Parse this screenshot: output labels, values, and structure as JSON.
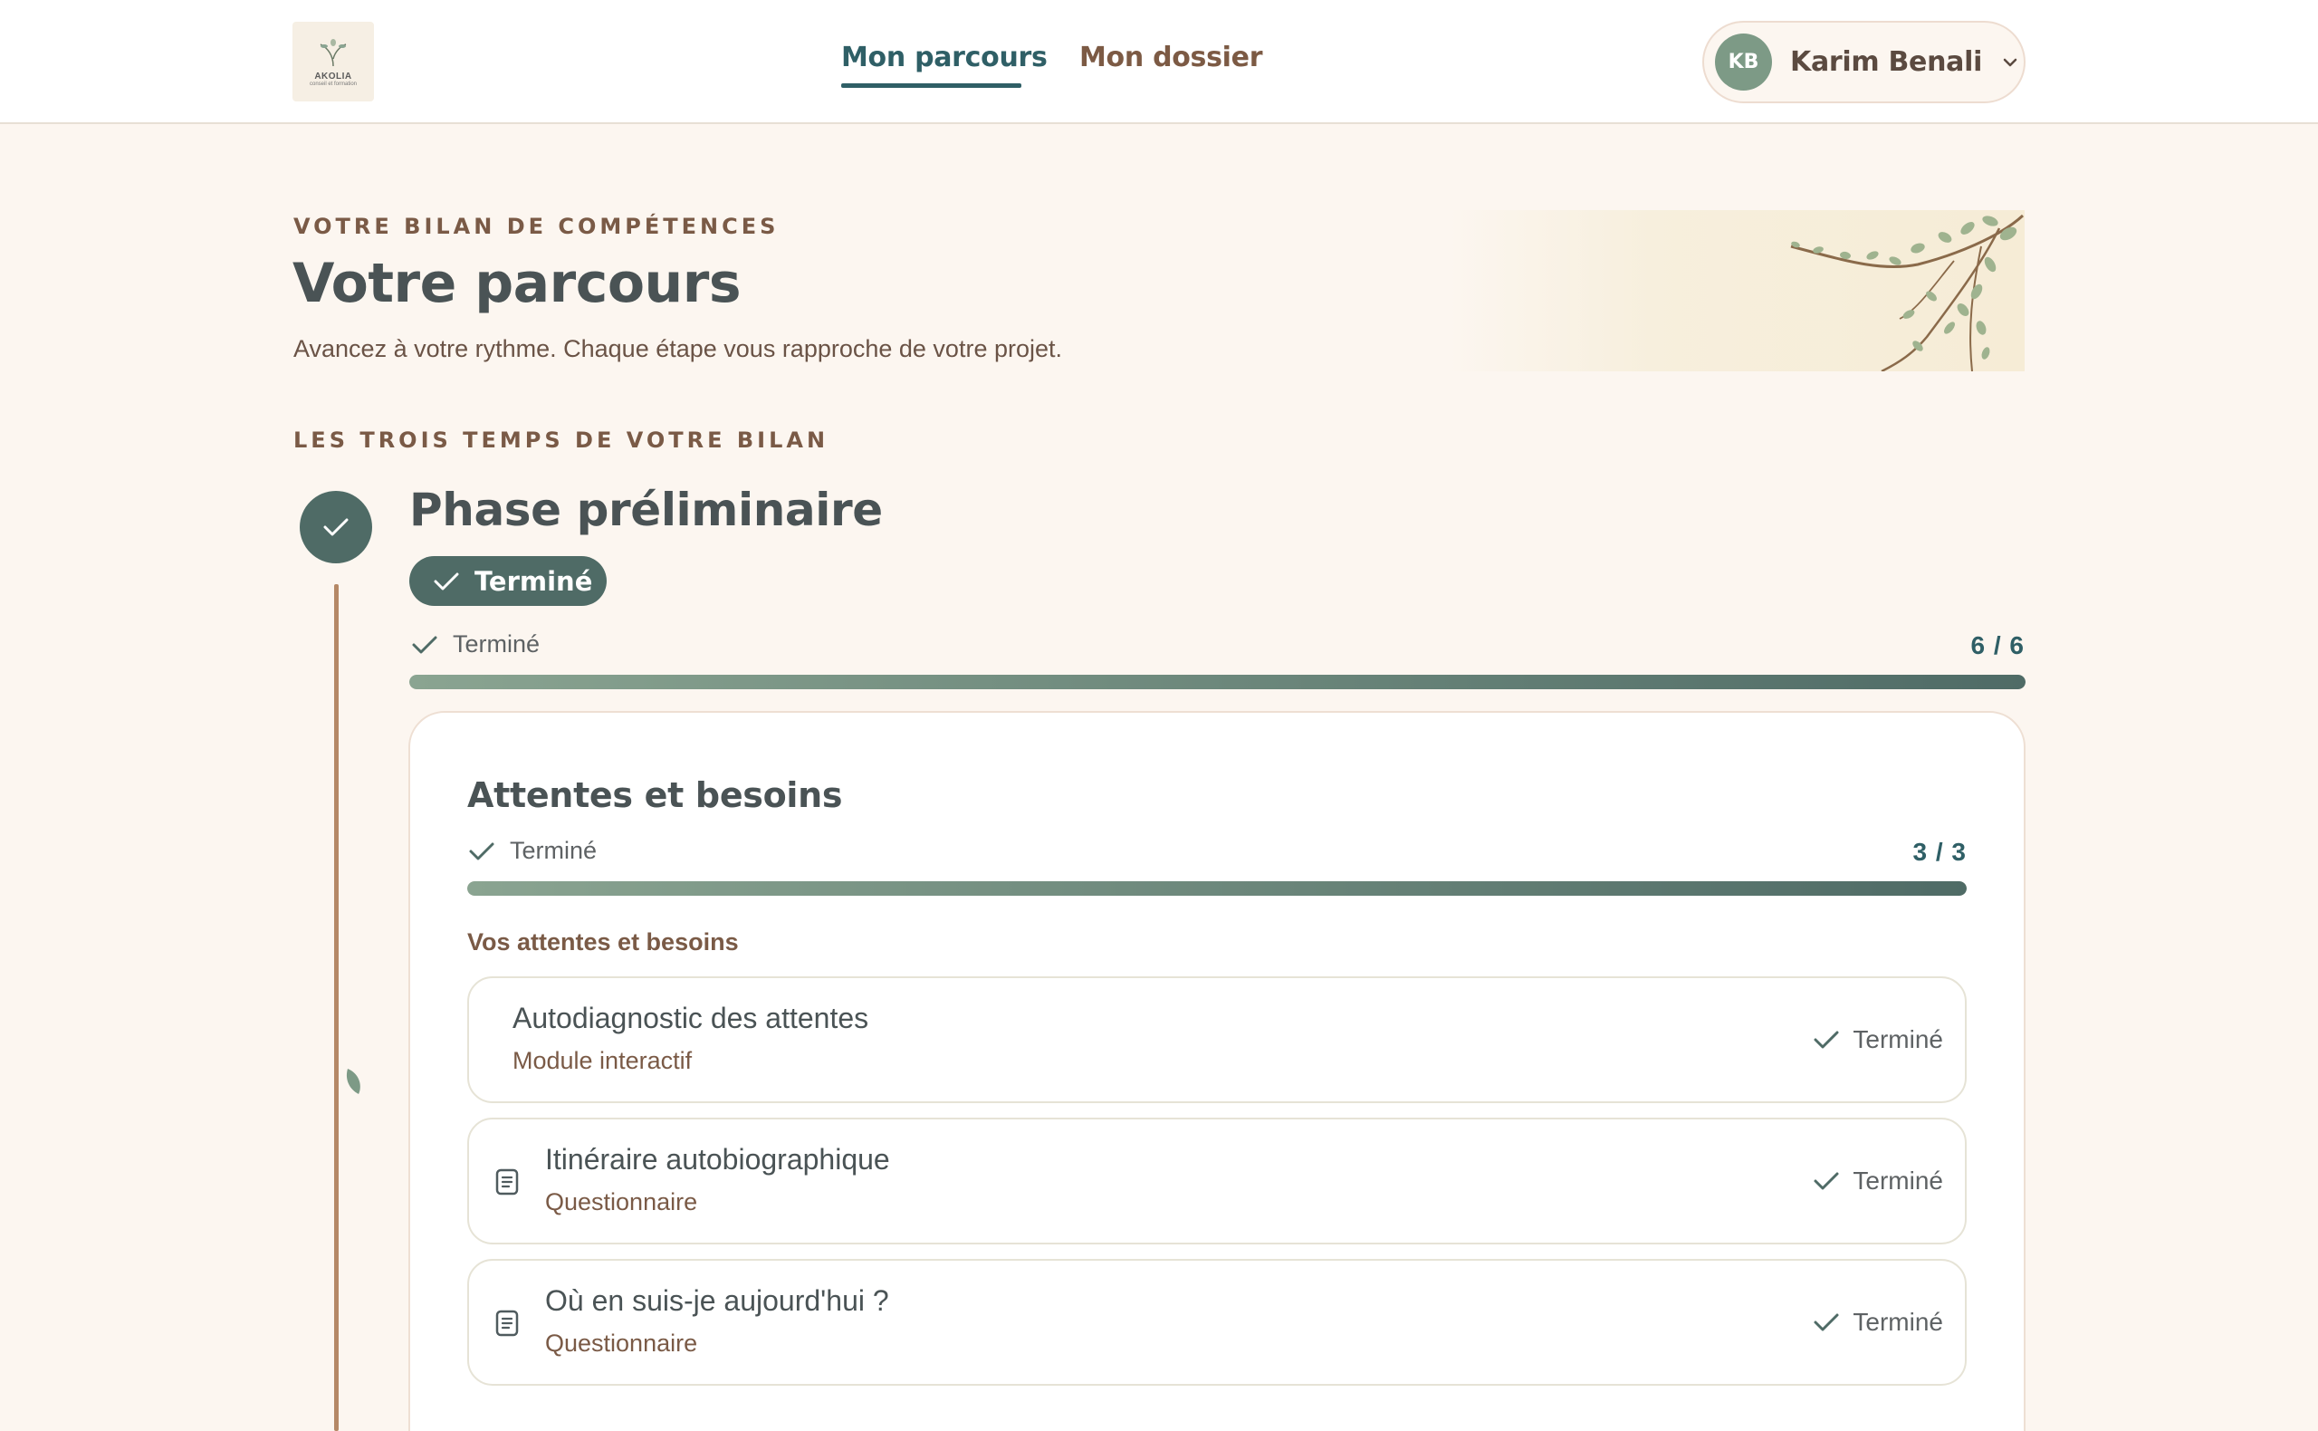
{
  "header": {
    "logo": {
      "name": "AKOLIA",
      "tagline": "conseil et formation"
    },
    "nav": [
      {
        "label": "Mon parcours",
        "active": true
      },
      {
        "label": "Mon dossier",
        "active": false
      }
    ],
    "user": {
      "initials": "KB",
      "name": "Karim Benali"
    }
  },
  "hero": {
    "eyebrow": "VOTRE BILAN DE COMPÉTENCES",
    "title": "Votre parcours",
    "subtitle": "Avancez à votre rythme. Chaque étape vous rapproche de votre projet."
  },
  "timeline": {
    "eyebrow": "LES TROIS TEMPS DE VOTRE BILAN",
    "phase": {
      "title": "Phase préliminaire",
      "badge": "Terminé",
      "status": "Terminé",
      "count": "6 / 6",
      "progress": 1.0
    },
    "card": {
      "title": "Attentes et besoins",
      "status": "Terminé",
      "count": "3 / 3",
      "progress": 1.0,
      "section_label": "Vos attentes et besoins",
      "items": [
        {
          "title": "Autodiagnostic des attentes",
          "subtitle": "Module interactif",
          "status": "Terminé",
          "icon": "none"
        },
        {
          "title": "Itinéraire autobiographique",
          "subtitle": "Questionnaire",
          "status": "Terminé",
          "icon": "document-icon"
        },
        {
          "title": "Où en suis-je aujourd'hui ?",
          "subtitle": "Questionnaire",
          "status": "Terminé",
          "icon": "document-icon"
        }
      ]
    }
  },
  "colors": {
    "background": "#fcf6f0",
    "primary": "#4f6b66",
    "accent": "#2f5f66",
    "brown": "#7a5a46",
    "timeline": "#b58866"
  }
}
